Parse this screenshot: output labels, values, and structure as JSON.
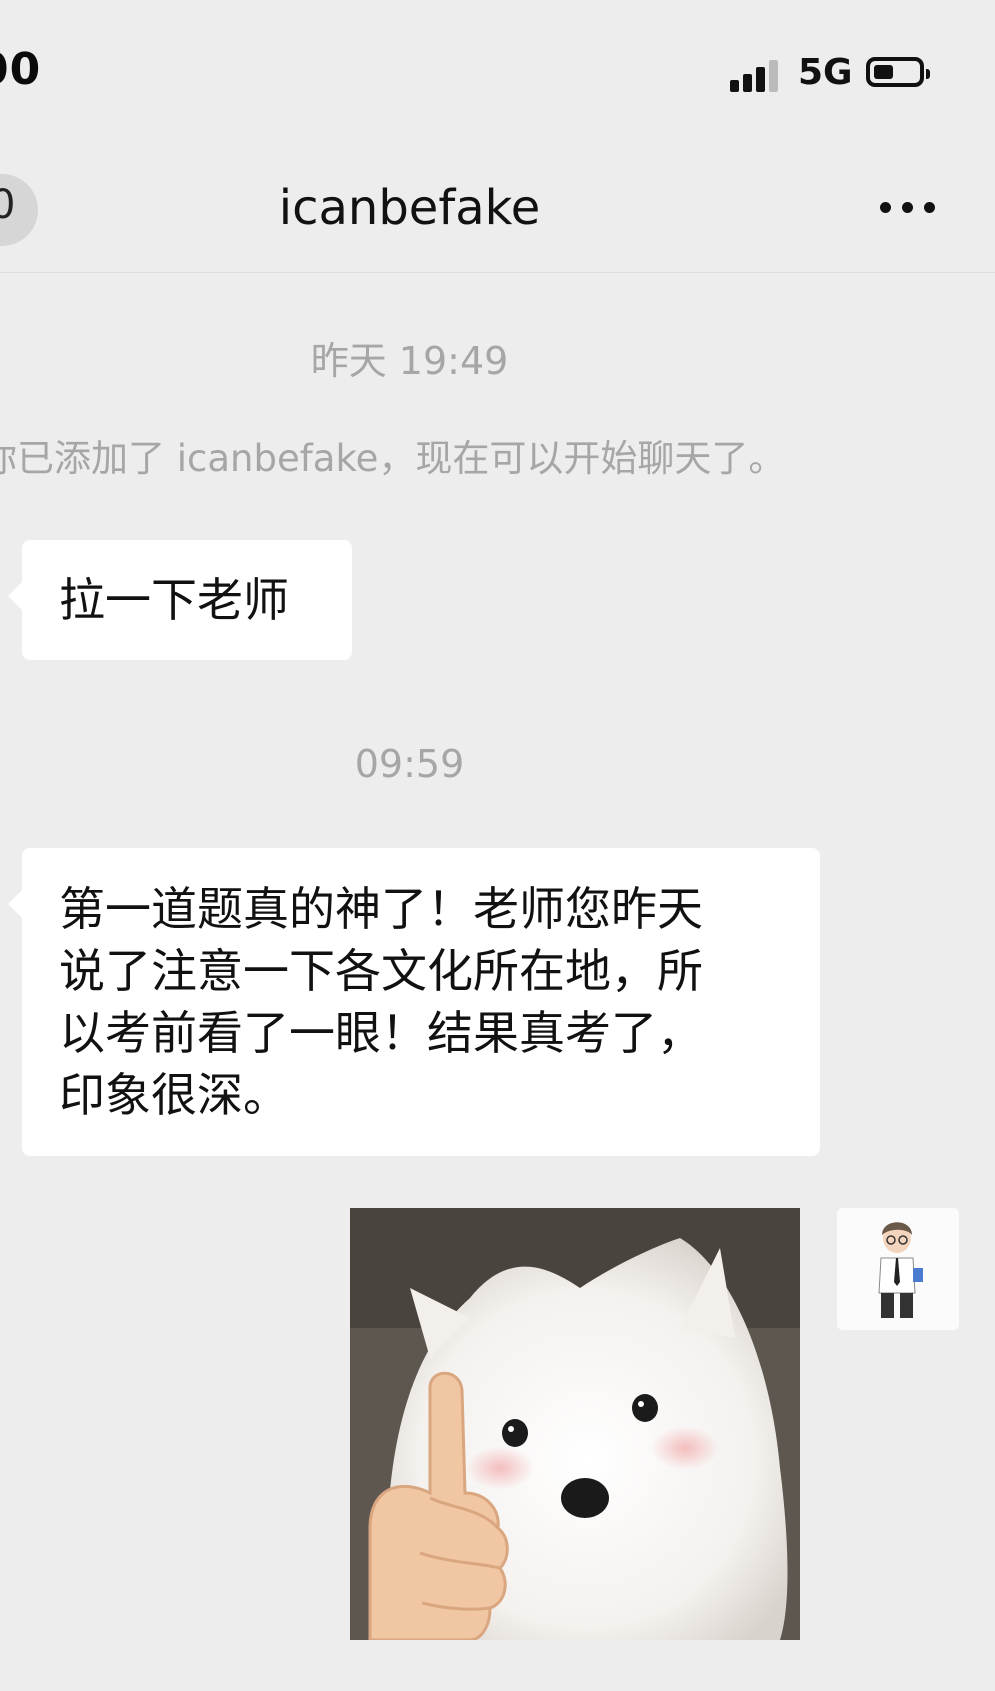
{
  "status_bar": {
    "time": "00",
    "network": "5G",
    "signal_bars": 3,
    "battery_level": 0.45
  },
  "nav": {
    "back_label": "0",
    "title": "icanbefake",
    "more_icon": "more-dots-icon"
  },
  "messages": [
    {
      "type": "timestamp",
      "text": "昨天 19:49"
    },
    {
      "type": "system",
      "text": "你已添加了 icanbefake，现在可以开始聊天了。"
    },
    {
      "type": "text",
      "side": "left",
      "text": "拉一下老师"
    },
    {
      "type": "timestamp",
      "text": "09:59"
    },
    {
      "type": "text",
      "side": "left",
      "text": "第一道题真的神了！老师您昨天\n说了注意一下各文化所在地，所\n以考前看了一眼！结果真考了，\n印象很深。"
    },
    {
      "type": "sticker",
      "side": "right",
      "description_icon": "thumbs-up-dog-sticker"
    }
  ],
  "colors": {
    "background": "#ededed",
    "bubble": "#ffffff",
    "muted_text": "#a6a6a6"
  }
}
